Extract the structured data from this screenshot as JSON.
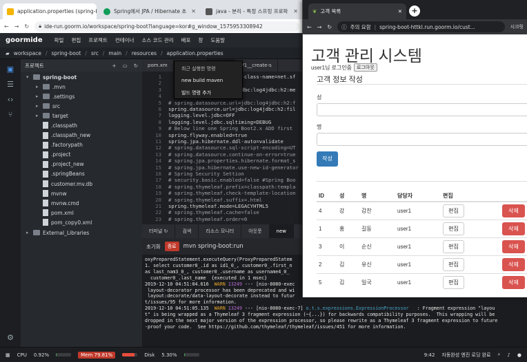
{
  "left_browser": {
    "tabs": [
      {
        "title": "application.properties (spring-b",
        "color": "#f4b400"
      },
      {
        "title": "Spring에서 JPA / Hibernate 초",
        "color": "#0f9d58"
      },
      {
        "title": "java - 분리 - 특정 스프링 프로파",
        "color": "#555555"
      }
    ],
    "url": "ide-run.goorm.io/workspace/spring-boot?language=kor#g_window_1575953308942"
  },
  "menubar": {
    "logo": "goormide",
    "items": [
      "파일",
      "편집",
      "프로젝트",
      "컨테이너",
      "소스 코드 관리",
      "배포",
      "창",
      "도움말"
    ]
  },
  "breadcrumb": [
    "workspace",
    "spring-boot",
    "src",
    "main",
    "resources",
    "application.properties"
  ],
  "project": {
    "header": "프로젝트",
    "root": "spring-boot",
    "items": [
      {
        "name": ".mvn",
        "type": "folder"
      },
      {
        "name": ".settings",
        "type": "folder"
      },
      {
        "name": "src",
        "type": "folder"
      },
      {
        "name": "target",
        "type": "folder"
      },
      {
        "name": ".classpath",
        "type": "file"
      },
      {
        "name": ".classpath_new",
        "type": "file"
      },
      {
        "name": ".factorypath",
        "type": "file"
      },
      {
        "name": ".project",
        "type": "file"
      },
      {
        "name": ".project_new",
        "type": "file"
      },
      {
        "name": ".springBeans",
        "type": "file"
      },
      {
        "name": "customer.mv.db",
        "type": "file"
      },
      {
        "name": "mvnw",
        "type": "file"
      },
      {
        "name": "mvnw.cmd",
        "type": "file"
      },
      {
        "name": "pom.xml",
        "type": "file"
      },
      {
        "name": "pom_copy0.xml",
        "type": "file"
      }
    ],
    "external": "External_Libraries"
  },
  "editor": {
    "tabs": [
      "pom.xm",
      "perties",
      "V1__create-s"
    ],
    "context_menu": [
      "최근 실행한 명령",
      "new build maven",
      "빌드 명령 추가"
    ],
    "lines": [
      {
        "n": "1",
        "t": "                   river-class-name=net.sf"
      },
      {
        "n": "2",
        "t": ""
      },
      {
        "n": "3",
        "t": "                   url=jdbc:log4jdbc:h2:me"
      },
      {
        "n": "4",
        "t": ""
      },
      {
        "n": "5",
        "t": "# spring.datasource.url=jdbc:log4jdbc:h2:f"
      },
      {
        "n": "6",
        "t": "spring.datasource.url=jdbc:log4jdbc:h2:fil"
      },
      {
        "n": "7",
        "t": "logging.level.jdbc=OFF"
      },
      {
        "n": "8",
        "t": "logging.level.jdbc.sqltiming=DEBUG"
      },
      {
        "n": "9",
        "t": "# Below line one Spring Boot2.x ADD first"
      },
      {
        "n": "10",
        "t": "spring.flyway.enabled=true"
      },
      {
        "n": "11",
        "t": "spring.jpa.hibernate.ddl-auto=validate"
      },
      {
        "n": "12",
        "t": "# spring.datasource.sql-script-encoding=UT"
      },
      {
        "n": "13",
        "t": "# spring.datasource.continue-on-error=true"
      },
      {
        "n": "14",
        "t": "# spring.jpa.properties.hibernate.format_s"
      },
      {
        "n": "15",
        "t": "# spring.jpa.hibernate.use-new-id-generator"
      },
      {
        "n": "16",
        "t": "# Spring Security Settion"
      },
      {
        "n": "17",
        "t": "# security.basic.enabled=false #Spring Boo"
      },
      {
        "n": "18",
        "t": "# spring.thymeleaf.prefix=classpath:templa"
      },
      {
        "n": "19",
        "t": "# spring.thymeleaf.check-template-location"
      },
      {
        "n": "20",
        "t": "# spring.thymeleaf.suffix=.html"
      },
      {
        "n": "21",
        "t": "spring.thymeleaf.mode=LEGACYHTML5"
      },
      {
        "n": "22",
        "t": "# spring.thymeleaf.cache=false"
      },
      {
        "n": "23",
        "t": "# spring.thymeleaf.order=0"
      }
    ]
  },
  "bottom": {
    "tabs": [
      "터미널",
      "검색",
      "리소스 모니터",
      "아웃풋",
      "new"
    ],
    "sub_left": "초기화",
    "stop": "종료",
    "run_label": "mvn spring-boot:run",
    "terminal": [
      {
        "parts": [
          {
            "t": "oxyPreparedStatement.executeQuery(ProxyPreparedStatem"
          }
        ]
      },
      {
        "parts": [
          {
            "t": "1. select customer0_.id as id1_0_, customer0_.first_n"
          }
        ]
      },
      {
        "parts": [
          {
            "t": "as last_nam3_0_, customer0_.username as username4_0_"
          }
        ]
      },
      {
        "parts": [
          {
            "t": "  customer0_.last_name  {executed in 1 msec}"
          }
        ]
      },
      {
        "parts": [
          {
            "t": "2019-12-10 04:51:04.616  "
          },
          {
            "t": "WARN",
            "c": "warn"
          },
          {
            "t": " "
          },
          {
            "t": "13249",
            "c": "pid"
          },
          {
            "t": " --- [nio-8080-exec"
          }
        ]
      },
      {
        "parts": [
          {
            "t": " layout-decorator processor has been deprecated and wi"
          }
        ]
      },
      {
        "parts": [
          {
            "t": " layout:decorate/data-layout-decorate instead to futur"
          }
        ]
      },
      {
        "parts": [
          {
            "t": "t/issues/95 for more information."
          }
        ]
      },
      {
        "parts": [
          {
            "t": "2019-12-10 04:51:05.135  "
          },
          {
            "t": "WARN",
            "c": "warn"
          },
          {
            "t": " "
          },
          {
            "t": "13249",
            "c": "pid"
          },
          {
            "t": " --- [nio-8080-exec-7] "
          },
          {
            "t": "o.t.s.expressions.ExpressionProcessor",
            "c": "cls"
          },
          {
            "t": "   : Fragment expression \"layou"
          }
        ]
      },
      {
        "parts": [
          {
            "t": "t\" is being wrapped as a Thymeleaf 3 fragment expression (~{...}) for backwards compatibility purposes.  This wrapping will be"
          }
        ]
      },
      {
        "parts": [
          {
            "t": "dropped in the next major version of the expression processor, so please rewrite as a Thymeleaf 3 fragment expression to future"
          }
        ]
      },
      {
        "parts": [
          {
            "t": "-proof your code.  See https://github.com/thymeleaf/thymeleaf/issues/451 for more information."
          }
        ]
      }
    ]
  },
  "status": {
    "cpu_label": "CPU",
    "cpu": "0.92%",
    "cpu_fraction": 0.0092,
    "mem_label": "Mem",
    "mem": "79.81%",
    "mem_fraction": 0.7981,
    "disk_label": "Disk",
    "disk": "5.30%",
    "disk_fraction": 0.053,
    "time": "9:42",
    "right_text": "자동완성 엔진 로딩 완료"
  },
  "right_browser": {
    "tab_title": "고객 목록",
    "security_label": "주의 요함",
    "url": "spring-boot-httkl.run.goorm.io/cust...",
    "extra": "시크릿"
  },
  "app": {
    "title": "고객 관리 시스템",
    "login_text": "user1님 로그인중",
    "logout": "로그아웃",
    "form_title": "고객 정보 작성",
    "first_label": "성",
    "last_label": "명",
    "submit": "작성",
    "table": {
      "headers": [
        "ID",
        "성",
        "명",
        "담당자",
        "편집",
        ""
      ],
      "rows": [
        {
          "id": "4",
          "first": "강",
          "last": "감찬",
          "owner": "user1"
        },
        {
          "id": "1",
          "first": "홍",
          "last": "길동",
          "owner": "user1"
        },
        {
          "id": "3",
          "first": "이",
          "last": "순신",
          "owner": "user1"
        },
        {
          "id": "2",
          "first": "김",
          "last": "유신",
          "owner": "user1"
        },
        {
          "id": "5",
          "first": "김",
          "last": "일국",
          "owner": "user1"
        }
      ],
      "edit_label": "편집",
      "delete_label": "삭제"
    }
  }
}
